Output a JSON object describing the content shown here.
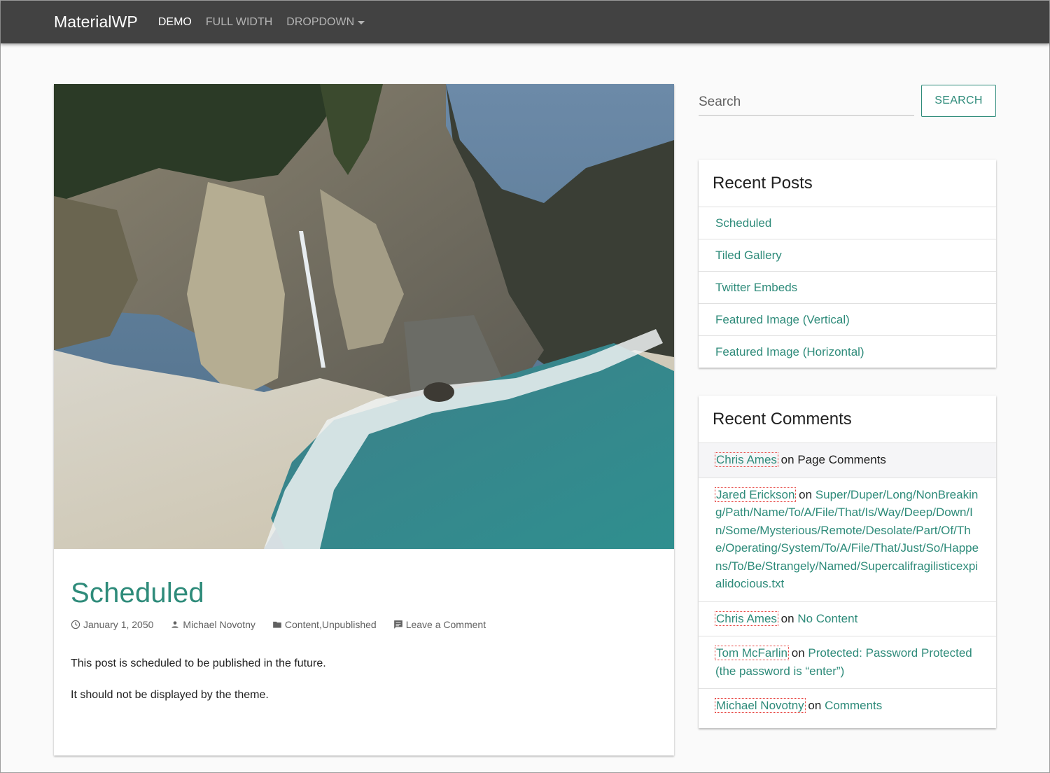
{
  "navbar": {
    "brand": "MaterialWP",
    "items": [
      {
        "label": "DEMO",
        "active": true
      },
      {
        "label": "FULL WIDTH",
        "active": false
      },
      {
        "label": "DROPDOWN",
        "active": false,
        "has_caret": true
      }
    ]
  },
  "post": {
    "featured_image_alt": "Coastal cove with waterfall onto beach",
    "title": "Scheduled",
    "meta": {
      "date": "January 1, 2050",
      "author": "Michael Novotny",
      "categories": [
        "Content",
        "Unpublished"
      ],
      "category_separator": ", ",
      "comments_link": "Leave a Comment"
    },
    "paragraphs": [
      "This post is scheduled to be published in the future.",
      "It should not be displayed by the theme."
    ]
  },
  "search": {
    "placeholder": "Search",
    "value": "",
    "button_label": "SEARCH"
  },
  "recent_posts": {
    "title": "Recent Posts",
    "items": [
      {
        "label": "Scheduled"
      },
      {
        "label": "Tiled Gallery"
      },
      {
        "label": "Twitter Embeds"
      },
      {
        "label": "Featured Image (Vertical)"
      },
      {
        "label": "Featured Image (Horizontal)"
      }
    ]
  },
  "recent_comments": {
    "title": "Recent Comments",
    "connector": "on",
    "items": [
      {
        "author": "Chris Ames",
        "post": "Page Comments",
        "post_is_link": false
      },
      {
        "author": "Jared Erickson",
        "post": "Super/Duper/Long/NonBreaking/Path/Name/To/A/File/That/Is/Way/Deep/Down/In/Some/Mysterious/Remote/Desolate/Part/Of/The/Operating/System/To/A/File/That/Just/So/Happens/To/Be/Strangely/Named/Supercalifragilisticexpialidocious.txt",
        "post_is_link": true
      },
      {
        "author": "Chris Ames",
        "post": "No Content",
        "post_is_link": true
      },
      {
        "author": "Tom McFarlin",
        "post": "Protected: Password Protected (the password is “enter”)",
        "post_is_link": true
      },
      {
        "author": "Michael Novotny",
        "post": "Comments",
        "post_is_link": true
      }
    ]
  },
  "colors": {
    "accent": "#2e8b7a",
    "navbar_bg": "#424242",
    "page_bg": "#fafafa",
    "author_outline": "#e53935"
  }
}
